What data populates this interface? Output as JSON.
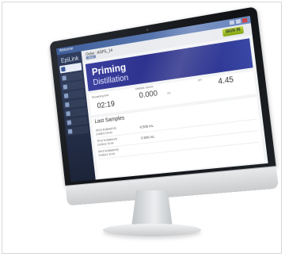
{
  "window": {
    "title": "Welcome"
  },
  "sidebar": {
    "brand": "EpiLink"
  },
  "header": {
    "order_label": "Order : ASPS_14",
    "order_button": "Show",
    "start_button": "SIGN IN"
  },
  "status": {
    "line1": "Priming",
    "line2": "Distillation"
  },
  "metrics": {
    "time_label": "Remaining time",
    "time_value": "02:19",
    "volume_label": "Distilled volume",
    "volume_value": "0.000",
    "volume_unit": "mL",
    "ph_label": "pH",
    "ph_value": "4.45"
  },
  "samples": {
    "title": "Last Samples",
    "rows": [
      {
        "id": "SPLD M (Batch10)",
        "date": "21/05/12 09:42",
        "value": "0.505 mL"
      },
      {
        "id": "TPLD M (Batch10)",
        "date": "21/05/12 10:04",
        "value": "0.509 mL"
      },
      {
        "id": "SPLD M (Batch10)",
        "date": "21/05/12 10:33",
        "value": ""
      }
    ]
  }
}
